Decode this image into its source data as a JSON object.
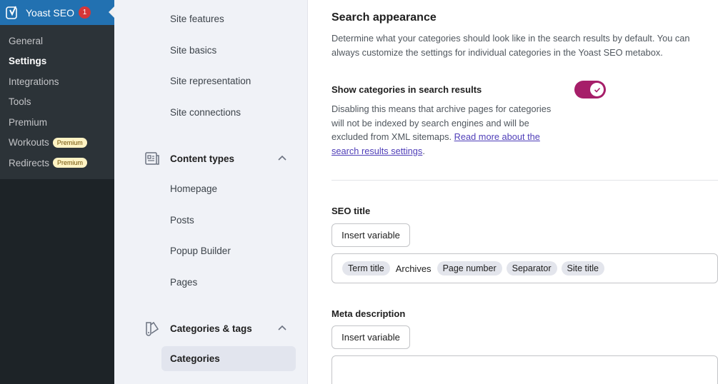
{
  "wp_sidebar": {
    "title": "Yoast SEO",
    "badge": "1",
    "items": [
      {
        "label": "General"
      },
      {
        "label": "Settings"
      },
      {
        "label": "Integrations"
      },
      {
        "label": "Tools"
      },
      {
        "label": "Premium"
      },
      {
        "label": "Workouts",
        "badge": "Premium"
      },
      {
        "label": "Redirects",
        "badge": "Premium"
      }
    ]
  },
  "settings_nav": {
    "site_links": [
      "Site features",
      "Site basics",
      "Site representation",
      "Site connections"
    ],
    "content_types": {
      "label": "Content types",
      "items": [
        "Homepage",
        "Posts",
        "Popup Builder",
        "Pages"
      ]
    },
    "categories_tags": {
      "label": "Categories & tags",
      "active_item": "Categories"
    }
  },
  "main": {
    "heading": "Search appearance",
    "description": "Determine what your categories should look like in the search results by default. You can always customize the settings for individual categories in the Yoast SEO metabox.",
    "toggle": {
      "label": "Show categories in search results",
      "description": "Disabling this means that archive pages for categories will not be indexed by search engines and will be excluded from XML sitemaps.",
      "link_text": "Read more about the search results settings",
      "suffix": ".",
      "enabled": true
    },
    "seo_title": {
      "label": "SEO title",
      "insert_button": "Insert variable",
      "tokens": [
        {
          "type": "chip",
          "text": "Term title"
        },
        {
          "type": "text",
          "text": "Archives"
        },
        {
          "type": "chip",
          "text": "Page number"
        },
        {
          "type": "chip",
          "text": "Separator"
        },
        {
          "type": "chip",
          "text": "Site title"
        }
      ]
    },
    "meta_description": {
      "label": "Meta description",
      "insert_button": "Insert variable"
    }
  },
  "colors": {
    "toggle_on": "#a61e69",
    "wp_sidebar": "#1d2327",
    "wp_active": "#2271b1"
  }
}
